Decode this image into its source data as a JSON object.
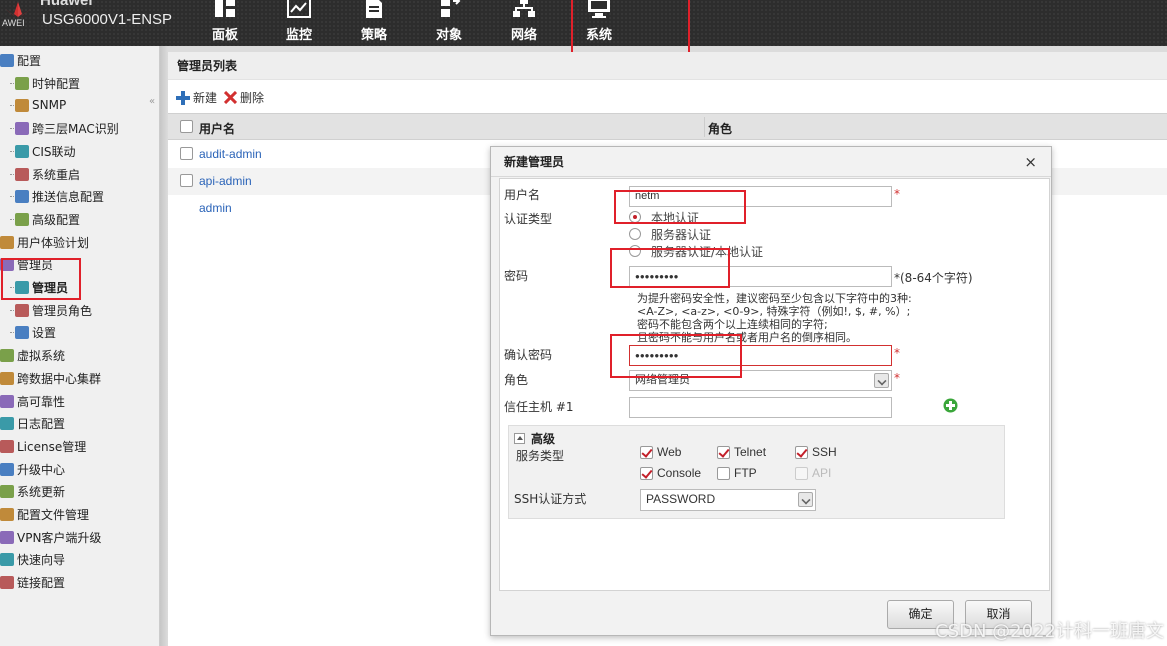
{
  "header": {
    "brand": "Huawei",
    "brand_sub": "AWEI",
    "model": "USG6000V1-ENSP",
    "nav": [
      {
        "label": "面板",
        "icon": "dashboard-icon"
      },
      {
        "label": "监控",
        "icon": "monitor-chart-icon"
      },
      {
        "label": "策略",
        "icon": "policy-document-icon"
      },
      {
        "label": "对象",
        "icon": "object-icon"
      },
      {
        "label": "网络",
        "icon": "network-icon"
      },
      {
        "label": "系统",
        "icon": "system-computer-icon",
        "active": true
      }
    ]
  },
  "sidebar": {
    "items": [
      {
        "label": "配置",
        "icon": "config-icon",
        "level": 0
      },
      {
        "label": "时钟配置",
        "icon": "clock-icon",
        "level": 1
      },
      {
        "label": "SNMP",
        "icon": "snmp-icon",
        "level": 1
      },
      {
        "label": "跨三层MAC识别",
        "icon": "mac-identify-icon",
        "level": 1
      },
      {
        "label": "CIS联动",
        "icon": "cis-icon",
        "level": 1
      },
      {
        "label": "系统重启",
        "icon": "restart-icon",
        "level": 1
      },
      {
        "label": "推送信息配置",
        "icon": "push-info-icon",
        "level": 1
      },
      {
        "label": "高级配置",
        "icon": "advanced-config-icon",
        "level": 1
      },
      {
        "label": "用户体验计划",
        "icon": "user-experience-icon",
        "level": 0
      },
      {
        "label": "管理员",
        "icon": "admin-folder-icon",
        "level": 0
      },
      {
        "label": "管理员",
        "icon": "admin-icon",
        "level": 1,
        "selected": true
      },
      {
        "label": "管理员角色",
        "icon": "admin-role-icon",
        "level": 1
      },
      {
        "label": "设置",
        "icon": "settings-icon",
        "level": 1
      },
      {
        "label": "虚拟系统",
        "icon": "virtual-system-icon",
        "level": 0
      },
      {
        "label": "跨数据中心集群",
        "icon": "cluster-icon",
        "level": 0
      },
      {
        "label": "高可靠性",
        "icon": "high-availability-icon",
        "level": 0
      },
      {
        "label": "日志配置",
        "icon": "log-icon",
        "level": 0
      },
      {
        "label": "License管理",
        "icon": "license-icon",
        "level": 0
      },
      {
        "label": "升级中心",
        "icon": "upgrade-icon",
        "level": 0
      },
      {
        "label": "系统更新",
        "icon": "system-update-icon",
        "level": 0
      },
      {
        "label": "配置文件管理",
        "icon": "config-file-icon",
        "level": 0
      },
      {
        "label": "VPN客户端升级",
        "icon": "vpn-icon",
        "level": 0
      },
      {
        "label": "快速向导",
        "icon": "wizard-icon",
        "level": 0
      },
      {
        "label": "链接配置",
        "icon": "link-icon",
        "level": 0
      }
    ]
  },
  "main": {
    "title": "管理员列表",
    "toolbar": {
      "new_label": "新建",
      "delete_label": "删除"
    },
    "table": {
      "columns": [
        "用户名",
        "角色"
      ],
      "rows": [
        {
          "username": "audit-admin",
          "checkbox": true
        },
        {
          "username": "api-admin",
          "checkbox": true
        },
        {
          "username": "admin",
          "checkbox": false
        }
      ]
    }
  },
  "dialog": {
    "title": "新建管理员",
    "close": "×",
    "username_label": "用户名",
    "username_value": "netm",
    "auth_type_label": "认证类型",
    "auth_options": [
      "本地认证",
      "服务器认证",
      "服务器认证/本地认证"
    ],
    "auth_selected": 0,
    "password_label": "密码",
    "password_value": "●●●●●●●●●",
    "password_req": "*(8-64个字符)",
    "hint": [
      "为提升密码安全性，建议密码至少包含以下字符中的3种:",
      "<A-Z>, <a-z>, <0-9>, 特殊字符（例如!, $, #, %）;",
      "密码不能包含两个以上连续相同的字符;",
      "且密码不能与用户名或者用户名的倒序相同。"
    ],
    "confirm_label": "确认密码",
    "confirm_value": "●●●●●●●●●",
    "role_label": "角色",
    "role_value": "网络管理员",
    "trust_host_label": "信任主机 #1",
    "required_mark": "*",
    "advanced": {
      "title": "高级",
      "service_type_label": "服务类型",
      "services": [
        {
          "label": "Web",
          "checked": true,
          "disabled": false
        },
        {
          "label": "Telnet",
          "checked": true,
          "disabled": false
        },
        {
          "label": "SSH",
          "checked": true,
          "disabled": false
        },
        {
          "label": "Console",
          "checked": true,
          "disabled": false
        },
        {
          "label": "FTP",
          "checked": false,
          "disabled": false
        },
        {
          "label": "API",
          "checked": false,
          "disabled": true
        }
      ],
      "ssh_auth_label": "SSH认证方式",
      "ssh_auth_value": "PASSWORD"
    },
    "ok_label": "确定",
    "cancel_label": "取消"
  },
  "watermark": "CSDN @2022计科一班唐文",
  "colors": {
    "accent_red": "#e0202a",
    "link_blue": "#2a63b8",
    "topbar": "#2d2d2d"
  }
}
